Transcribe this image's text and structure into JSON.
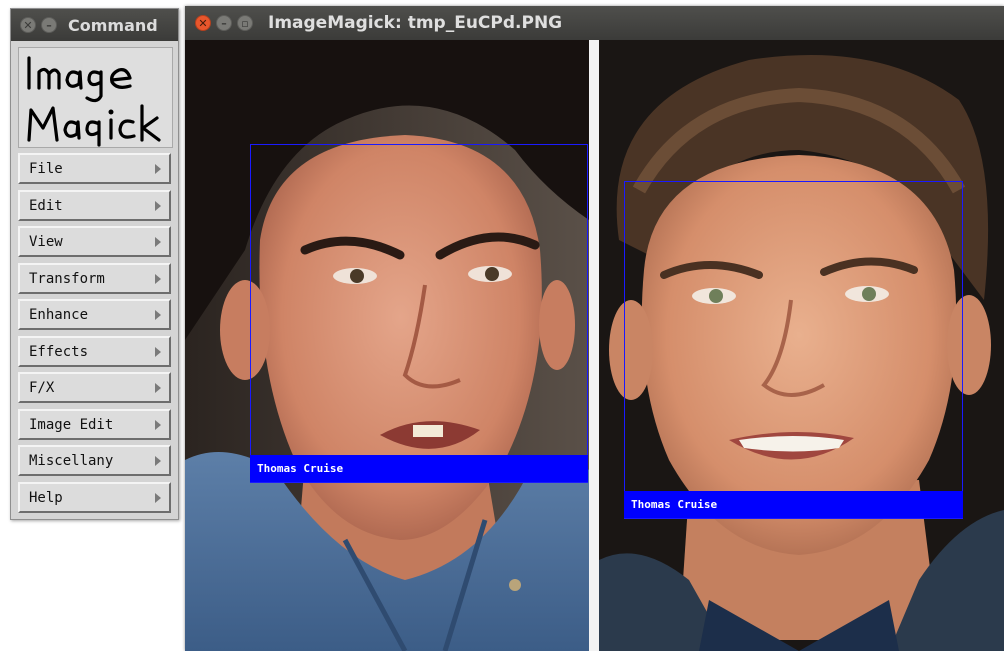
{
  "command_window": {
    "title": "Command",
    "logo_text": "Image Magick",
    "menu": [
      "File",
      "Edit",
      "View",
      "Transform",
      "Enhance",
      "Effects",
      "F/X",
      "Image Edit",
      "Miscellany",
      "Help"
    ]
  },
  "image_window": {
    "title": "ImageMagick: tmp_EuCPd.PNG",
    "detections": [
      {
        "label": "Thomas Cruise"
      },
      {
        "label": "Thomas Cruise"
      }
    ]
  },
  "colors": {
    "titlebar": "#3d3d3b",
    "close_button": "#e8562c",
    "panel_bg": "#d4d4d4",
    "box_stroke": "#0000ff",
    "label_bg": "#0000ff",
    "label_text": "#ffffff"
  },
  "icons": {
    "close": "close-icon",
    "minimize": "minimize-icon",
    "maximize": "maximize-icon",
    "submenu": "triangle-right-icon"
  }
}
